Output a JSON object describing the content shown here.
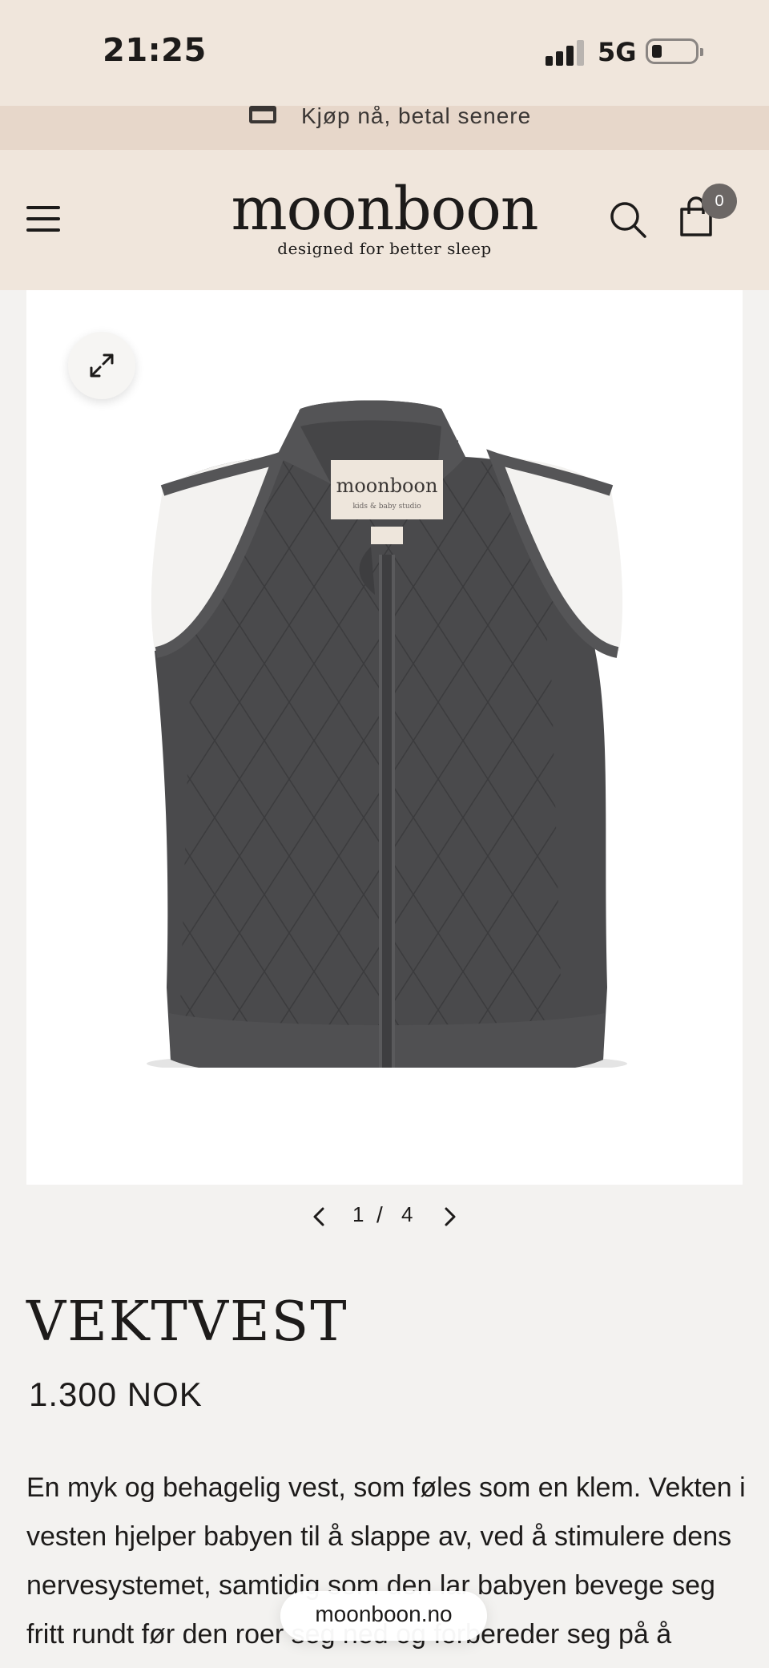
{
  "status_bar": {
    "time": "21:25",
    "network": "5G",
    "battery_level": 0.2
  },
  "promo": {
    "icon": "credit-card-icon",
    "text": "Kjøp nå, betal senere"
  },
  "header": {
    "menu_icon": "hamburger-menu-icon",
    "logo": "moonboon",
    "tagline": "designed for better sleep",
    "search_icon": "search-icon",
    "cart_icon": "shopping-bag-icon",
    "cart_count": "0"
  },
  "gallery": {
    "zoom_icon": "expand-icon",
    "current": "1",
    "separator": "/",
    "total": "4",
    "label_brand": "moonboon",
    "label_sub": "kids & baby studio"
  },
  "product": {
    "title": "VEKTVEST",
    "price": "1.300 NOK",
    "description": "En myk og behagelig vest, som føles som en klem. Vekten i vesten hjelper babyen til å slappe av, ved å stimulere dens nervesystemet, samtidig som den lar babyen bevege seg fritt rundt før den roer seg ned og forbereder seg på å"
  },
  "browser": {
    "domain": "moonboon.no"
  },
  "colors": {
    "header_bg": "#f0e6dc",
    "promo_bg": "#e7d7ca",
    "page_bg": "#f3f2f0",
    "vest": "#4a4a4c",
    "text": "#1d1b1a"
  }
}
